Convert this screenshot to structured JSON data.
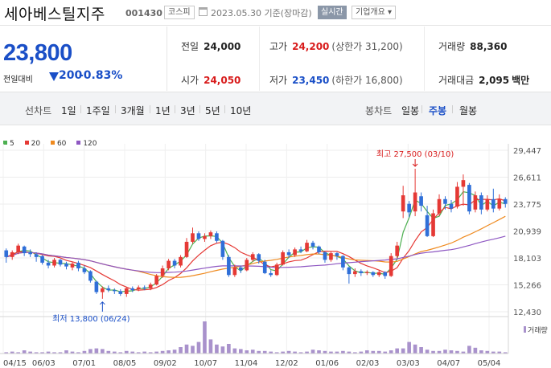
{
  "header": {
    "name": "세아베스틸지주",
    "code": "001430",
    "market": "코스피",
    "date": "2023.05.30 기준(장마감)",
    "live": "실시간",
    "overview": "기업개요 ▾"
  },
  "price": {
    "current": "23,800",
    "change_label": "전일대비",
    "change": "200",
    "change_pct": "-0.83%"
  },
  "stats": {
    "prev_label": "전일",
    "prev": "24,000",
    "high_label": "고가",
    "high": "24,200",
    "upper_limit": "(상한가 31,200)",
    "volume_label": "거래량",
    "volume": "88,360",
    "open_label": "시가",
    "open": "24,050",
    "low_label": "저가",
    "low": "23,450",
    "lower_limit": "(하한가 16,800)",
    "amount_label": "거래대금",
    "amount": "2,095",
    "amount_unit": "백만"
  },
  "periods": {
    "line_caption": "선차트",
    "line_options": [
      "1일",
      "1주일",
      "3개월",
      "1년",
      "3년",
      "5년",
      "10년"
    ],
    "candle_caption": "봉차트",
    "candle_options": [
      "일봉",
      "주봉",
      "월봉"
    ],
    "candle_selected": 1
  },
  "legend": [
    {
      "label": "5",
      "color": "#4caf50"
    },
    {
      "label": "20",
      "color": "#e53935"
    },
    {
      "label": "60",
      "color": "#ef8a1f"
    },
    {
      "label": "120",
      "color": "#8e57c2"
    }
  ],
  "colors": {
    "up": "#e53935",
    "down": "#2f6fd8",
    "volume": "#a992cc"
  },
  "chart_data": {
    "type": "candlestick",
    "y_ticks": [
      "29,447",
      "26,611",
      "23,775",
      "20,939",
      "18,103",
      "15,266",
      "12,430"
    ],
    "ylim": [
      12430,
      29447
    ],
    "x_ticks": [
      "04/15",
      "06/03",
      "07/01",
      "08/05",
      "09/02",
      "10/07",
      "11/04",
      "12/02",
      "01/06",
      "02/03",
      "03/03",
      "04/07",
      "05/04"
    ],
    "high_annotation": "최고 27,500 (03/10)",
    "low_annotation": "최저 13,800 (06/24)",
    "high_point": 27500,
    "low_point": 13800,
    "volume_label": "거래량",
    "candles": [
      [
        18900,
        18200,
        19100,
        17600
      ],
      [
        18200,
        18700,
        18900,
        17900
      ],
      [
        18700,
        19400,
        19600,
        18500
      ],
      [
        19300,
        18600,
        19400,
        18300
      ],
      [
        18700,
        18500,
        19000,
        18200
      ],
      [
        18500,
        18200,
        18700,
        17700
      ],
      [
        18300,
        17600,
        18400,
        17400
      ],
      [
        17600,
        17300,
        17900,
        17000
      ],
      [
        17300,
        17900,
        18100,
        17100
      ],
      [
        17900,
        17400,
        18000,
        17200
      ],
      [
        17500,
        17200,
        17700,
        16900
      ],
      [
        17100,
        17500,
        17700,
        16800
      ],
      [
        17600,
        17000,
        17800,
        16700
      ],
      [
        17000,
        16600,
        17300,
        16400
      ],
      [
        16700,
        15700,
        16800,
        15500
      ],
      [
        15600,
        14500,
        15700,
        14300
      ],
      [
        14500,
        14900,
        15100,
        13800
      ],
      [
        14900,
        14700,
        15200,
        14500
      ],
      [
        14700,
        14600,
        14900,
        14300
      ],
      [
        14600,
        14300,
        14800,
        14100
      ],
      [
        14300,
        14900,
        15000,
        14000
      ],
      [
        14900,
        14700,
        15100,
        14500
      ],
      [
        14800,
        15000,
        15200,
        14600
      ],
      [
        15000,
        14900,
        15200,
        14700
      ],
      [
        14900,
        15300,
        15500,
        14700
      ],
      [
        15300,
        16200,
        16400,
        15200
      ],
      [
        16200,
        17000,
        17300,
        16000
      ],
      [
        17000,
        17800,
        18000,
        16800
      ],
      [
        17800,
        17300,
        18000,
        17000
      ],
      [
        17300,
        18200,
        18400,
        17100
      ],
      [
        18200,
        19800,
        20200,
        18100
      ],
      [
        19800,
        20700,
        21300,
        19600
      ],
      [
        20700,
        20100,
        20900,
        19900
      ],
      [
        20100,
        20400,
        20700,
        19800
      ],
      [
        20400,
        20800,
        21000,
        20100
      ],
      [
        20700,
        19900,
        20900,
        19700
      ],
      [
        19900,
        18200,
        20000,
        17900
      ],
      [
        18200,
        16300,
        18400,
        16100
      ],
      [
        16300,
        17100,
        17400,
        16100
      ],
      [
        17100,
        16800,
        17300,
        16500
      ],
      [
        16800,
        17900,
        18100,
        16700
      ],
      [
        17900,
        18500,
        18700,
        17700
      ],
      [
        18500,
        17800,
        18600,
        17500
      ],
      [
        17700,
        16500,
        17900,
        16400
      ],
      [
        16500,
        16300,
        16800,
        16100
      ],
      [
        16300,
        17400,
        17600,
        16200
      ],
      [
        17400,
        18700,
        18900,
        17300
      ],
      [
        18700,
        18400,
        19000,
        18100
      ],
      [
        18400,
        19000,
        19200,
        18200
      ],
      [
        19000,
        18800,
        19300,
        18600
      ],
      [
        18800,
        19700,
        20000,
        18700
      ],
      [
        19700,
        19300,
        19900,
        19000
      ],
      [
        19300,
        18700,
        19400,
        18500
      ],
      [
        18700,
        17900,
        18800,
        17600
      ],
      [
        17900,
        18600,
        18800,
        17700
      ],
      [
        18600,
        18300,
        18700,
        17900
      ],
      [
        18300,
        17100,
        18400,
        16800
      ],
      [
        17100,
        16400,
        17200,
        15400
      ],
      [
        16400,
        16700,
        17000,
        16100
      ],
      [
        16700,
        16500,
        16900,
        16200
      ],
      [
        16500,
        16600,
        16800,
        16300
      ],
      [
        16600,
        16300,
        16700,
        16100
      ],
      [
        16300,
        16600,
        16800,
        16100
      ],
      [
        16600,
        16200,
        16700,
        15900
      ],
      [
        16200,
        18300,
        18600,
        16100
      ],
      [
        18300,
        19400,
        19800,
        18100
      ],
      [
        23000,
        24700,
        25700,
        22300
      ],
      [
        23800,
        22900,
        24100,
        22400
      ],
      [
        23000,
        25000,
        27500,
        22500
      ],
      [
        24600,
        23600,
        25000,
        23000
      ],
      [
        22600,
        20400,
        23600,
        20300
      ],
      [
        20400,
        22800,
        23200,
        20300
      ],
      [
        22800,
        24300,
        24800,
        22500
      ],
      [
        24300,
        23800,
        24600,
        23200
      ],
      [
        23800,
        23300,
        24200,
        22900
      ],
      [
        23500,
        25600,
        26100,
        23300
      ],
      [
        25600,
        26300,
        26900,
        23600
      ],
      [
        25800,
        23000,
        26000,
        22700
      ],
      [
        23200,
        24700,
        25100,
        22900
      ],
      [
        24700,
        23200,
        25000,
        22700
      ],
      [
        23200,
        24300,
        24700,
        23000
      ],
      [
        24300,
        23300,
        25400,
        22900
      ],
      [
        23300,
        24300,
        24800,
        23100
      ],
      [
        24300,
        23800,
        24500,
        23400
      ]
    ],
    "volumes": [
      2,
      3,
      2,
      5,
      3,
      2,
      2,
      3,
      2,
      2,
      5,
      3,
      2,
      4,
      7,
      8,
      7,
      4,
      3,
      2,
      4,
      3,
      2,
      3,
      2,
      3,
      4,
      5,
      6,
      10,
      14,
      12,
      18,
      50,
      22,
      14,
      11,
      15,
      8,
      7,
      5,
      6,
      4,
      4,
      3,
      2,
      3,
      4,
      3,
      2,
      3,
      6,
      5,
      4,
      3,
      3,
      4,
      3,
      2,
      3,
      5,
      4,
      4,
      3,
      5,
      8,
      8,
      18,
      14,
      10,
      6,
      4,
      4,
      6,
      5,
      4,
      3,
      12,
      9,
      5,
      4,
      3,
      3,
      2
    ]
  }
}
